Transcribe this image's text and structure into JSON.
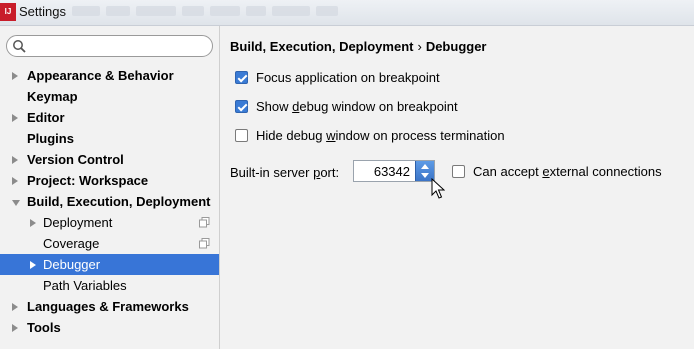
{
  "window": {
    "title": "Settings"
  },
  "search": {
    "placeholder": ""
  },
  "sidebar": {
    "items": [
      {
        "label": "Appearance & Behavior"
      },
      {
        "label": "Keymap"
      },
      {
        "label": "Editor"
      },
      {
        "label": "Plugins"
      },
      {
        "label": "Version Control"
      },
      {
        "label": "Project: Workspace"
      },
      {
        "label": "Build, Execution, Deployment"
      },
      {
        "label": "Deployment"
      },
      {
        "label": "Coverage"
      },
      {
        "label": "Debugger"
      },
      {
        "label": "Path Variables"
      },
      {
        "label": "Languages & Frameworks"
      },
      {
        "label": "Tools"
      }
    ],
    "selected": "Debugger"
  },
  "breadcrumb": {
    "parent": "Build, Execution, Deployment",
    "separator": "›",
    "current": "Debugger"
  },
  "options": {
    "focus_on_breakpoint": {
      "label": "Focus application on breakpoint",
      "checked": true
    },
    "show_debug_window": {
      "pre": "Show ",
      "mn": "d",
      "post": "ebug window on breakpoint",
      "checked": true
    },
    "hide_debug_window": {
      "pre": "Hide debug ",
      "mn": "w",
      "post": "indow on process termination",
      "checked": false
    }
  },
  "server_port": {
    "label_pre": "Built-in server ",
    "label_mn": "p",
    "label_post": "ort:",
    "value": "63342"
  },
  "external_connections": {
    "pre": "Can accept ",
    "mn": "e",
    "post": "xternal connections",
    "checked": false
  },
  "colors": {
    "selection": "#3875d7",
    "checkbox_checked": "#3a7bd5"
  }
}
